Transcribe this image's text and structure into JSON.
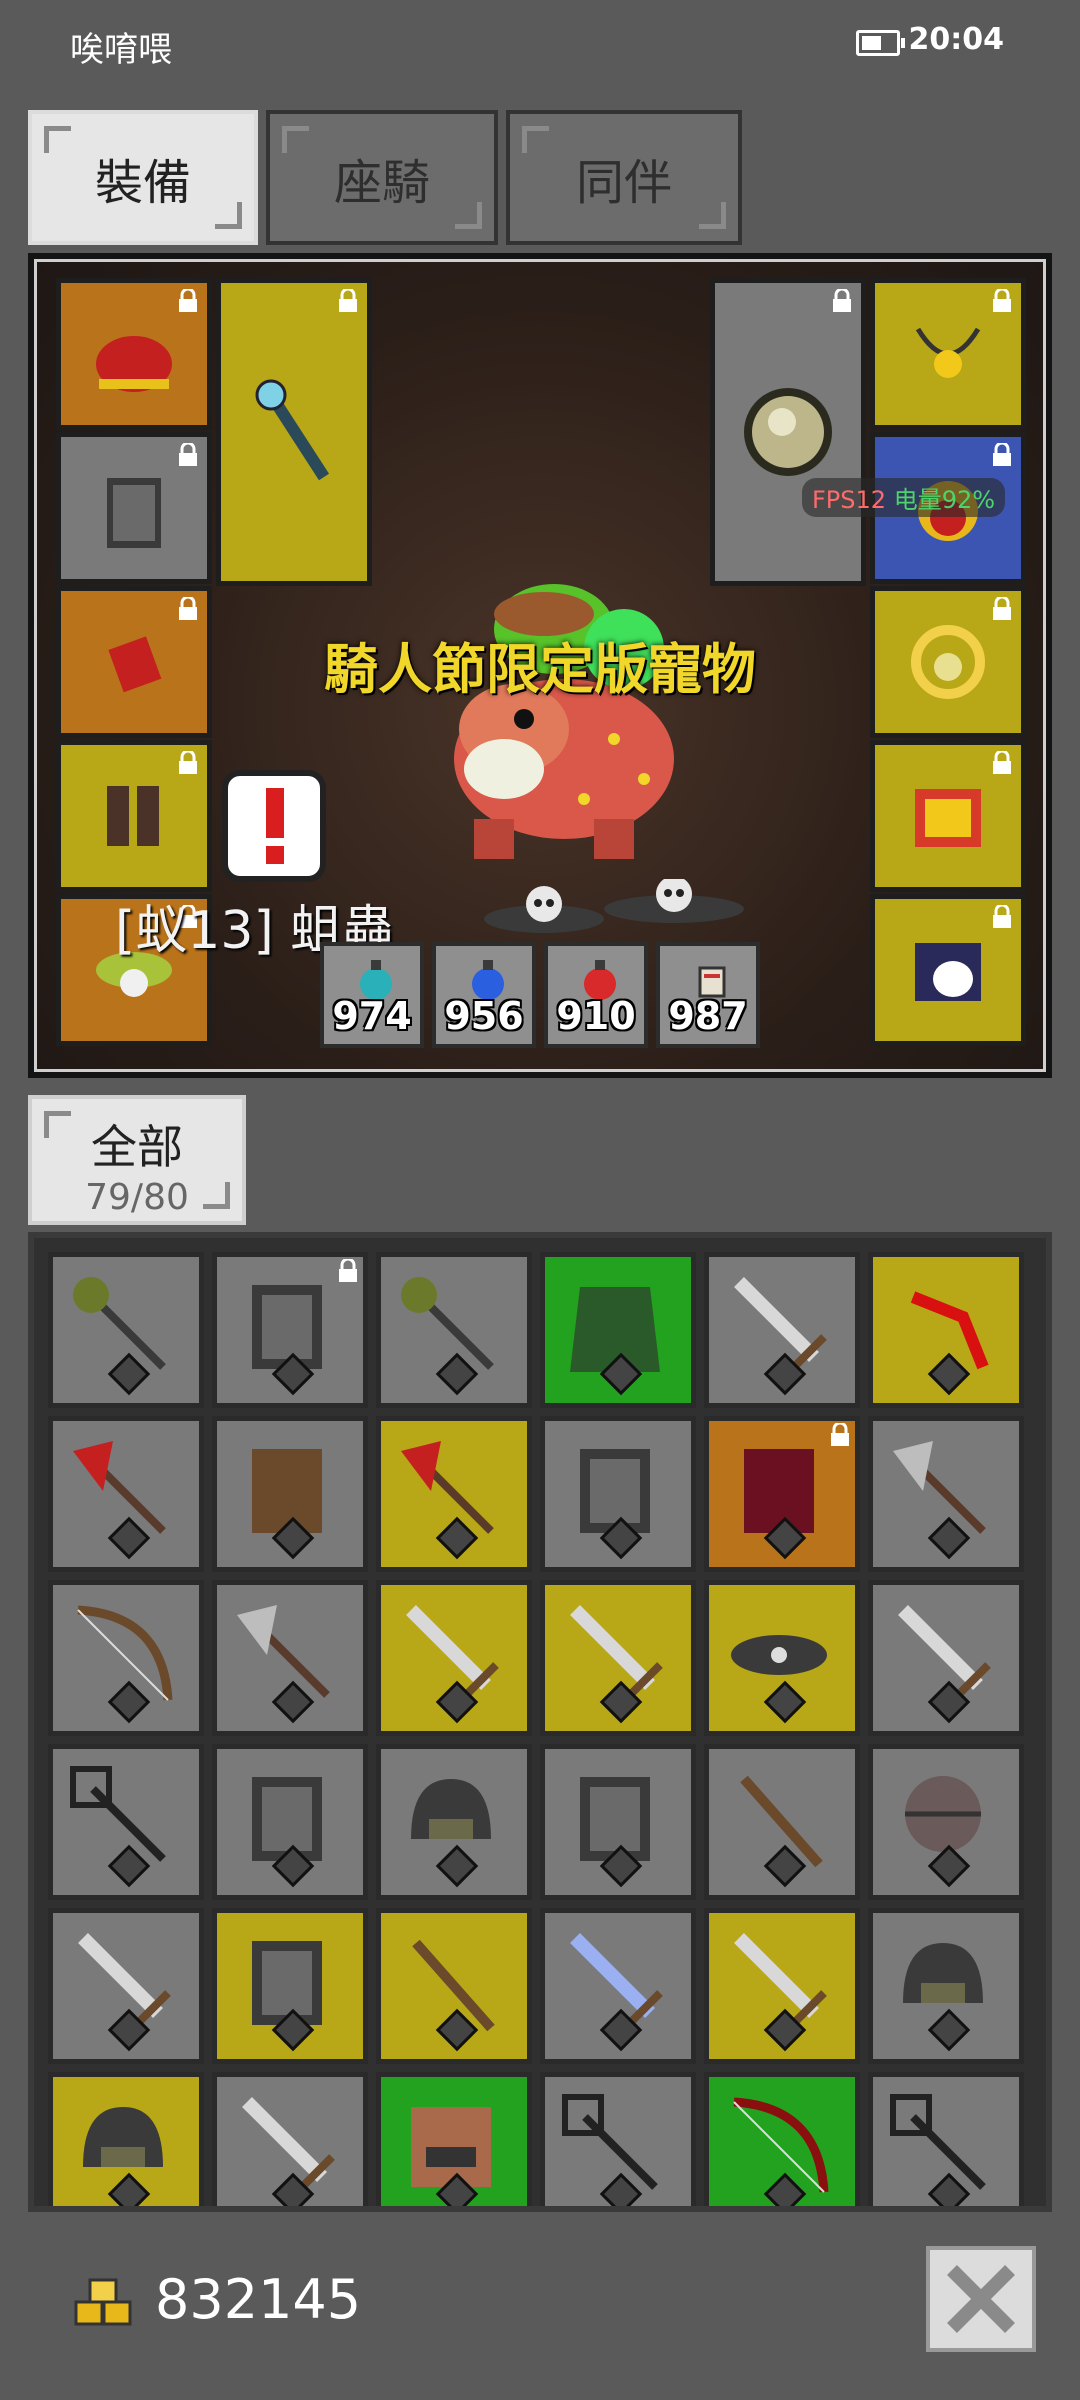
{
  "status_bar": {
    "carrier": "唉唷喂",
    "time": "20:04",
    "battery_level": 0.6
  },
  "tabs": [
    {
      "label": "裝備",
      "active": true
    },
    {
      "label": "座騎",
      "active": false
    },
    {
      "label": "同伴",
      "active": false
    }
  ],
  "equipment": {
    "event_label": "騎人節限定版寵物",
    "pet_name": "[蚁13] 蛆蟲",
    "left_slots": [
      {
        "icon": "red-helmet-icon",
        "color": "orange",
        "locked": true
      },
      {
        "icon": "chainmail-armor-icon",
        "color": "gray",
        "locked": true
      },
      {
        "icon": "red-glove-icon",
        "color": "orange",
        "locked": true
      },
      {
        "icon": "boots-icon",
        "color": "yellow",
        "locked": true
      },
      {
        "icon": "skull-amulet-icon",
        "color": "orange",
        "locked": true
      }
    ],
    "weapon_slot": {
      "icon": "wand-icon",
      "color": "yellow",
      "locked": true
    },
    "shield_slot": {
      "icon": "round-shield-icon",
      "color": "gray",
      "locked": true
    },
    "right_slots": [
      {
        "icon": "gold-necklace-icon",
        "color": "yellow",
        "locked": true
      },
      {
        "icon": "ruby-ring-icon",
        "color": "blue",
        "locked": true
      },
      {
        "icon": "gold-ring-icon",
        "color": "yellow",
        "locked": true
      },
      {
        "icon": "spell-book-icon",
        "color": "yellow",
        "locked": true
      },
      {
        "icon": "penguin-scroll-icon",
        "color": "yellow",
        "locked": true
      }
    ],
    "stats": [
      {
        "icon": "cyan-potion-icon",
        "value": "974"
      },
      {
        "icon": "blue-potion-icon",
        "value": "956"
      },
      {
        "icon": "red-potion-icon",
        "value": "910"
      },
      {
        "icon": "scroll-icon",
        "value": "987"
      }
    ],
    "overlay": {
      "fps": "FPS12",
      "power": "电量92%"
    }
  },
  "filter": {
    "label": "全部",
    "count": "79/80"
  },
  "inventory": [
    {
      "icon": "mace-icon",
      "color": "gray",
      "locked": false
    },
    {
      "icon": "chainmail-icon",
      "color": "gray",
      "locked": true
    },
    {
      "icon": "mace-icon",
      "color": "gray",
      "locked": false
    },
    {
      "icon": "green-cloak-icon",
      "color": "green",
      "locked": false
    },
    {
      "icon": "dagger-icon",
      "color": "gray",
      "locked": false
    },
    {
      "icon": "red-boomerang-icon",
      "color": "yellow",
      "locked": false
    },
    {
      "icon": "red-axe-icon",
      "color": "gray",
      "locked": false
    },
    {
      "icon": "leather-armor-icon",
      "color": "gray",
      "locked": false
    },
    {
      "icon": "red-axe-icon",
      "color": "yellow",
      "locked": false
    },
    {
      "icon": "iron-armor-icon",
      "color": "gray",
      "locked": false
    },
    {
      "icon": "crimson-armor-icon",
      "color": "orange",
      "locked": true
    },
    {
      "icon": "battle-axe-icon",
      "color": "gray",
      "locked": false
    },
    {
      "icon": "bow-icon",
      "color": "gray",
      "locked": false
    },
    {
      "icon": "battle-axe-icon",
      "color": "gray",
      "locked": false
    },
    {
      "icon": "sword-icon",
      "color": "yellow",
      "locked": false
    },
    {
      "icon": "sword-icon",
      "color": "yellow",
      "locked": false
    },
    {
      "icon": "belt-icon",
      "color": "yellow",
      "locked": false
    },
    {
      "icon": "sword-icon",
      "color": "gray",
      "locked": false
    },
    {
      "icon": "trident-icon",
      "color": "gray",
      "locked": false
    },
    {
      "icon": "chainmail-icon",
      "color": "gray",
      "locked": false
    },
    {
      "icon": "helmet-icon",
      "color": "gray",
      "locked": false
    },
    {
      "icon": "chainmail-icon",
      "color": "gray",
      "locked": false
    },
    {
      "icon": "staff-icon",
      "color": "gray",
      "locked": false
    },
    {
      "icon": "spiked-shield-icon",
      "color": "gray",
      "locked": false
    },
    {
      "icon": "sword-icon",
      "color": "gray",
      "locked": false
    },
    {
      "icon": "iron-armor-icon",
      "color": "yellow",
      "locked": false
    },
    {
      "icon": "staff-icon",
      "color": "yellow",
      "locked": false
    },
    {
      "icon": "blue-sword-icon",
      "color": "gray",
      "locked": false
    },
    {
      "icon": "sword-icon",
      "color": "yellow",
      "locked": false
    },
    {
      "icon": "helmet-icon",
      "color": "gray",
      "locked": false
    },
    {
      "icon": "chain-hood-icon",
      "color": "yellow",
      "locked": false
    },
    {
      "icon": "sword-icon",
      "color": "gray",
      "locked": false
    },
    {
      "icon": "pig-mask-icon",
      "color": "green",
      "locked": false
    },
    {
      "icon": "trident-icon",
      "color": "gray",
      "locked": false
    },
    {
      "icon": "red-bow-icon",
      "color": "green",
      "locked": false
    },
    {
      "icon": "trident-icon",
      "color": "gray",
      "locked": false
    }
  ],
  "gold": "832145",
  "colors": {
    "gray": "#7a7a7a",
    "yellow": "#b8a716",
    "orange": "#b9731a",
    "blue": "#3d55b2",
    "green": "#23a21f"
  }
}
